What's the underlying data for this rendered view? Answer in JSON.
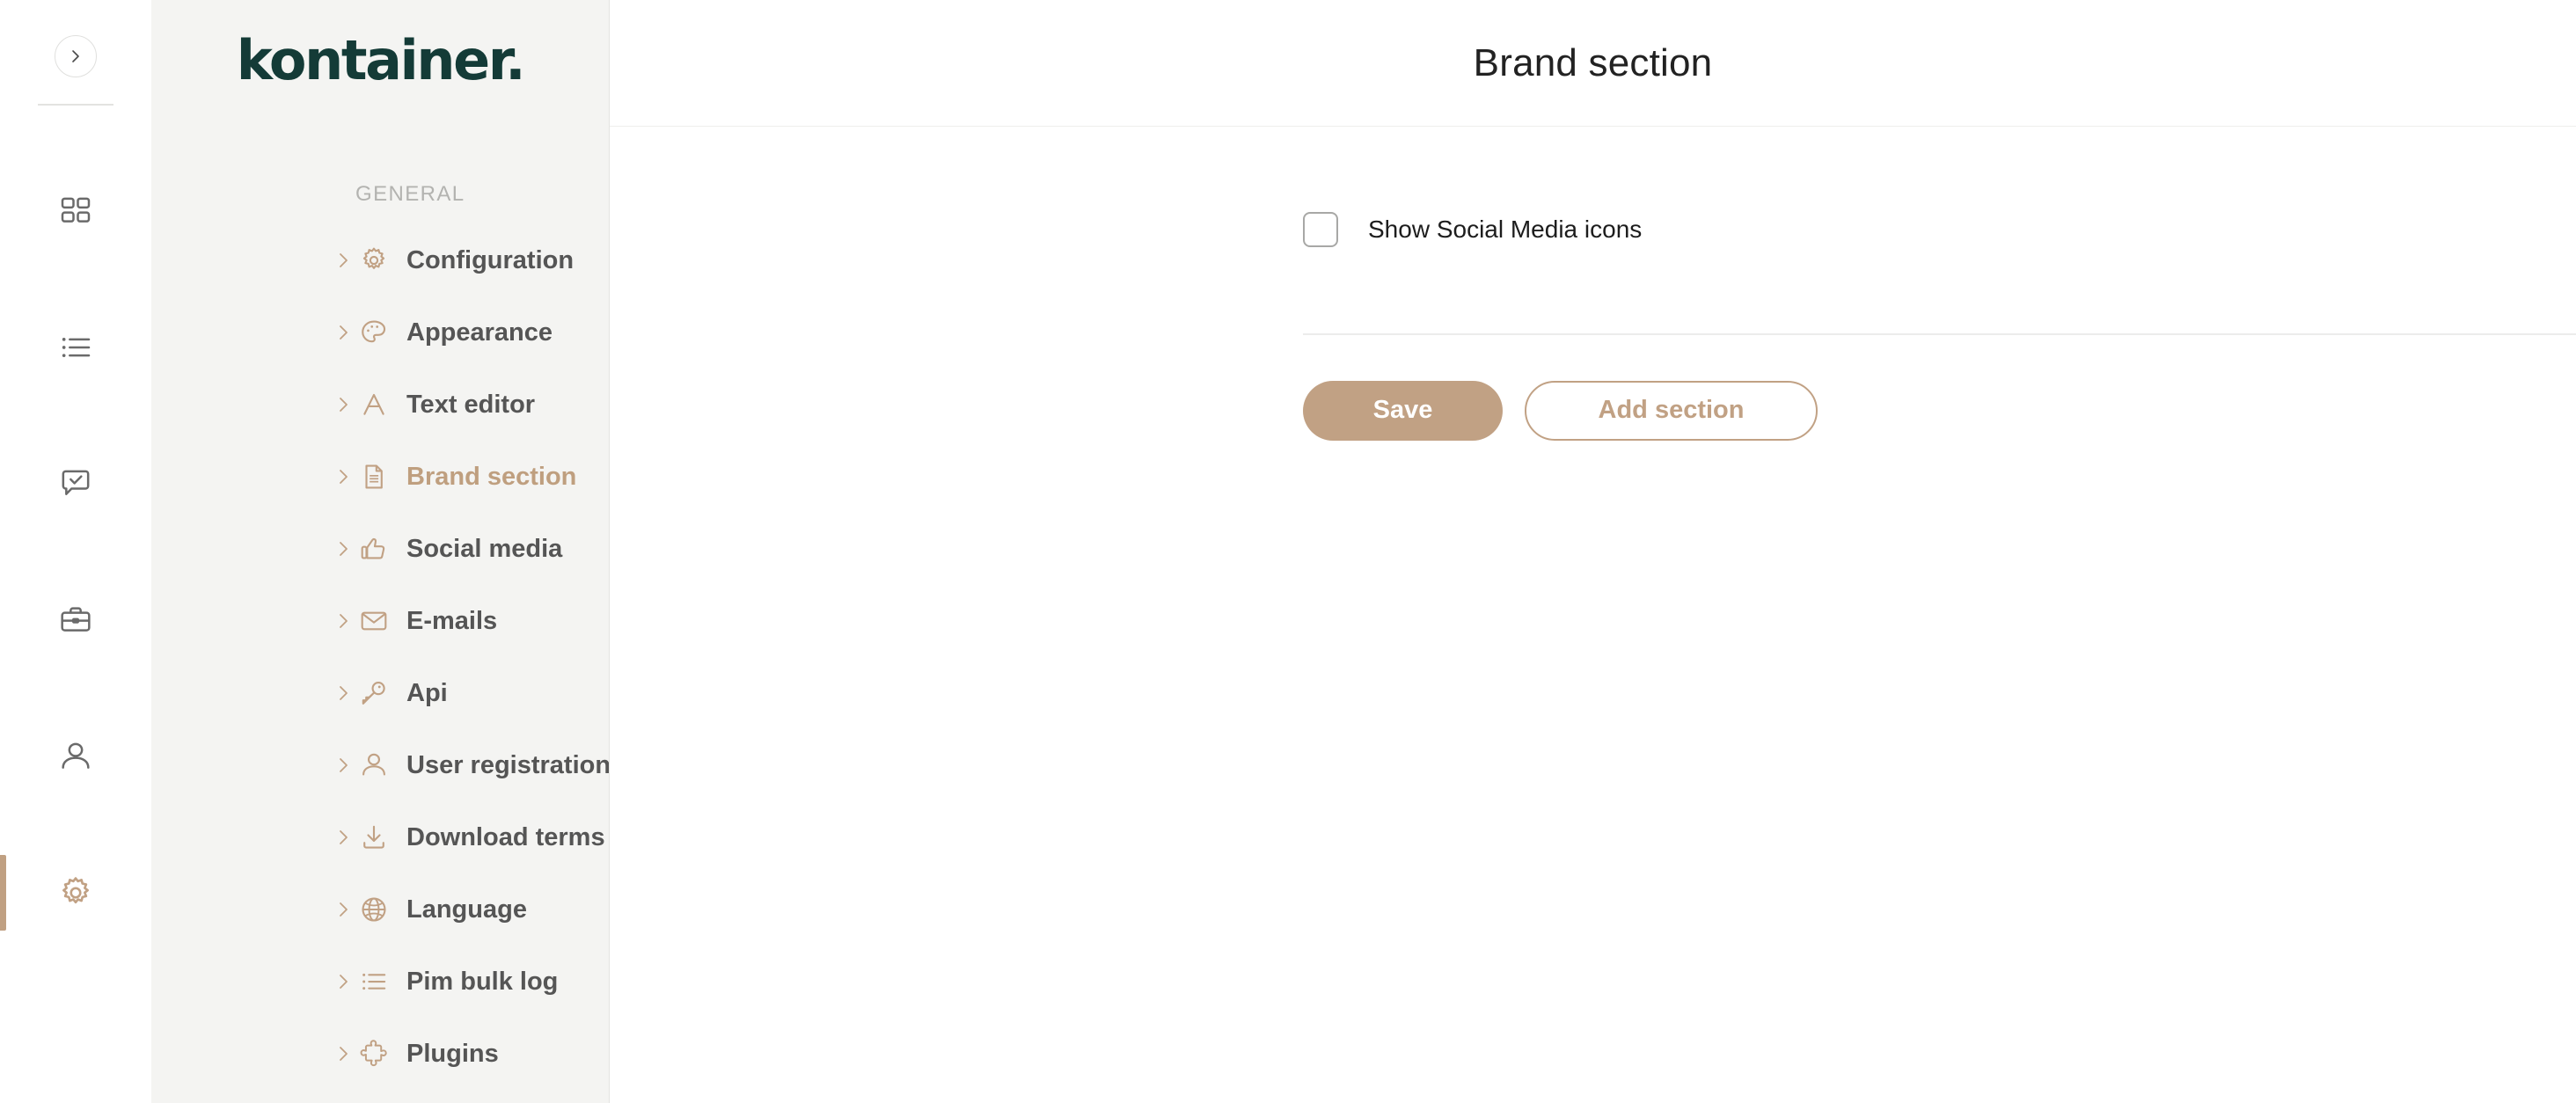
{
  "rail": {
    "toggle": {
      "icon": "chevron-right-icon",
      "label": "Expand navigation"
    },
    "items": [
      {
        "id": "dashboard",
        "icon": "grid-icon",
        "label": "Dashboard",
        "active": false
      },
      {
        "id": "collections",
        "icon": "list-icon",
        "label": "Collections",
        "active": false
      },
      {
        "id": "approvals",
        "icon": "chat-check-icon",
        "label": "Approvals",
        "active": false
      },
      {
        "id": "portals",
        "icon": "briefcase-icon",
        "label": "Portals",
        "active": false
      },
      {
        "id": "users",
        "icon": "user-icon",
        "label": "Users",
        "active": false
      },
      {
        "id": "settings",
        "icon": "gear-icon",
        "label": "Settings",
        "active": true
      }
    ]
  },
  "sidebar": {
    "logo": "kontainer.",
    "section_label": "GENERAL",
    "items": [
      {
        "icon": "gear-icon",
        "label": "Configuration",
        "active": false
      },
      {
        "icon": "palette-icon",
        "label": "Appearance",
        "active": false
      },
      {
        "icon": "text-a-icon",
        "label": "Text editor",
        "active": false
      },
      {
        "icon": "document-icon",
        "label": "Brand section",
        "active": true
      },
      {
        "icon": "thumbs-up-icon",
        "label": "Social media",
        "active": false
      },
      {
        "icon": "envelope-icon",
        "label": "E-mails",
        "active": false
      },
      {
        "icon": "key-icon",
        "label": "Api",
        "active": false
      },
      {
        "icon": "user-icon",
        "label": "User registration",
        "active": false
      },
      {
        "icon": "download-icon",
        "label": "Download terms",
        "active": false
      },
      {
        "icon": "globe-icon",
        "label": "Language",
        "active": false
      },
      {
        "icon": "list-icon",
        "label": "Pim bulk log",
        "active": false
      },
      {
        "icon": "puzzle-icon",
        "label": "Plugins",
        "active": false
      }
    ]
  },
  "main": {
    "title": "Brand section",
    "checkbox": {
      "label": "Show Social Media icons",
      "checked": false
    },
    "buttons": {
      "save": "Save",
      "add_section": "Add section"
    }
  },
  "colors": {
    "accent": "#c1a184",
    "brand_dark": "#143b37",
    "sidebar_bg": "#f4f4f2",
    "text": "#555555",
    "muted": "#b3b3b0"
  }
}
